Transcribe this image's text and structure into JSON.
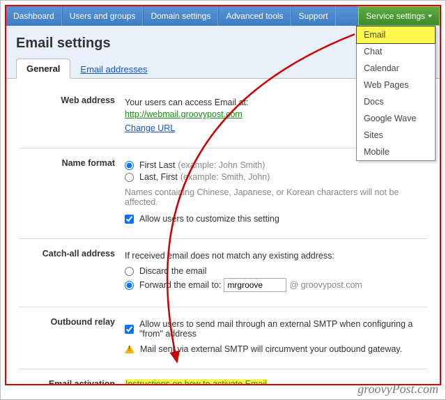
{
  "nav": {
    "items": [
      "Dashboard",
      "Users and groups",
      "Domain settings",
      "Advanced tools",
      "Support"
    ],
    "service": "Service settings"
  },
  "dropdown": {
    "items": [
      "Email",
      "Chat",
      "Calendar",
      "Web Pages",
      "Docs",
      "Google Wave",
      "Sites",
      "Mobile"
    ]
  },
  "page": {
    "title": "Email settings",
    "tabs": {
      "general": "General",
      "addresses": "Email addresses"
    }
  },
  "web_address": {
    "label": "Web address",
    "intro": "Your users can access Email at:",
    "url": "http://webmail.groovypost.com",
    "change": "Change URL"
  },
  "name_format": {
    "label": "Name format",
    "opt1": "First Last",
    "opt1_hint": "(example: John Smith)",
    "opt2": "Last, First",
    "opt2_hint": "(example: Smith, John)",
    "note": "Names containing Chinese, Japanese, or Korean characters will not be affected.",
    "allow_custom": "Allow users to customize this setting"
  },
  "catch_all": {
    "label": "Catch-all address",
    "intro": "If received email does not match any existing address:",
    "discard": "Discard the email",
    "forward": "Forward the email to:",
    "forward_value": "mrgroove",
    "domain_suffix": "@ groovypost.com"
  },
  "outbound": {
    "label": "Outbound relay",
    "allow": "Allow users to send mail through an external SMTP when configuring a \"from\" address",
    "warn": "Mail sent via external SMTP will circumvent your outbound gateway."
  },
  "activation": {
    "label": "Email activation",
    "link": "Instructions on how to activate Email"
  },
  "watermark": "groovyPost.com"
}
